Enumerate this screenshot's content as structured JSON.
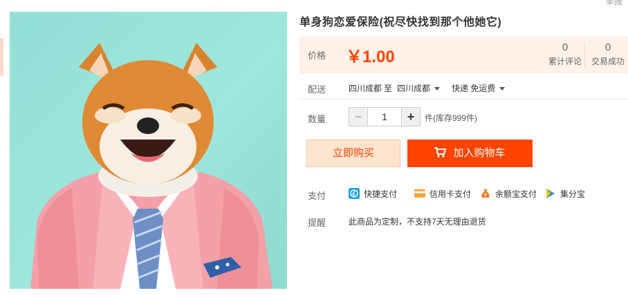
{
  "corner": {
    "text": "举报"
  },
  "product": {
    "title": "单身狗恋爱保险(祝尽快找到那个他她它)"
  },
  "price": {
    "label": "价格",
    "value": "￥1.00",
    "reviews_count": "0",
    "reviews_label": "累计评论",
    "sales_count": "0",
    "sales_label": "交易成功"
  },
  "delivery": {
    "label": "配送",
    "from": "四川成都",
    "to_word": "至",
    "to": "四川成都",
    "method": "快递 免运费"
  },
  "quantity": {
    "label": "数量",
    "minus": "−",
    "value": "1",
    "plus": "+",
    "stock": "件(库存999件)"
  },
  "actions": {
    "buy_now": "立即购买",
    "add_to_cart": "加入购物车"
  },
  "payment": {
    "label": "支付",
    "methods": [
      {
        "label": "快捷支付",
        "icon": "quick-pay-icon",
        "color": "#1a9be6"
      },
      {
        "label": "信用卡支付",
        "icon": "credit-card-icon",
        "color": "#f5a43a"
      },
      {
        "label": "余额宝支付",
        "icon": "yuebao-icon",
        "color": "#f07a2a"
      },
      {
        "label": "集分宝",
        "icon": "jifenbao-icon",
        "color": "#3bb54a"
      }
    ]
  },
  "remind": {
    "label": "提醒",
    "text": "此商品为定制，不支持7天无理由退货"
  },
  "colors": {
    "accent": "#ff4400",
    "price_bg": "#fff2e8",
    "buy_now_bg": "#ffe4d0",
    "image_bg": "#9fe6dc"
  }
}
